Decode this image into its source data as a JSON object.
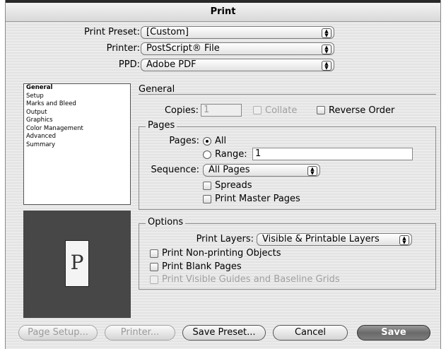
{
  "window": {
    "title": "Print"
  },
  "header": {
    "preset_label": "Print Preset:",
    "preset_value": "[Custom]",
    "printer_label": "Printer:",
    "printer_value": "PostScript® File",
    "ppd_label": "PPD:",
    "ppd_value": "Adobe PDF"
  },
  "sidebar": {
    "items": [
      {
        "label": "General"
      },
      {
        "label": "Setup"
      },
      {
        "label": "Marks and Bleed"
      },
      {
        "label": "Output"
      },
      {
        "label": "Graphics"
      },
      {
        "label": "Color Management"
      },
      {
        "label": "Advanced"
      },
      {
        "label": "Summary"
      }
    ]
  },
  "preview": {
    "page_letter": "P"
  },
  "general": {
    "heading": "General",
    "copies_label": "Copies:",
    "copies_value": "1",
    "collate_label": "Collate",
    "reverse_label": "Reverse Order"
  },
  "pages": {
    "group_title": "Pages",
    "pages_label": "Pages:",
    "all_label": "All",
    "range_label": "Range:",
    "range_value": "1",
    "sequence_label": "Sequence:",
    "sequence_value": "All Pages",
    "spreads_label": "Spreads",
    "master_label": "Print Master Pages"
  },
  "options": {
    "group_title": "Options",
    "layers_label": "Print Layers:",
    "layers_value": "Visible & Printable Layers",
    "nonprinting_label": "Print Non-printing Objects",
    "blank_label": "Print Blank Pages",
    "guides_label": "Print Visible Guides and Baseline Grids"
  },
  "buttons": {
    "page_setup": "Page Setup...",
    "printer": "Printer...",
    "save_preset": "Save Preset...",
    "cancel": "Cancel",
    "save": "Save"
  }
}
